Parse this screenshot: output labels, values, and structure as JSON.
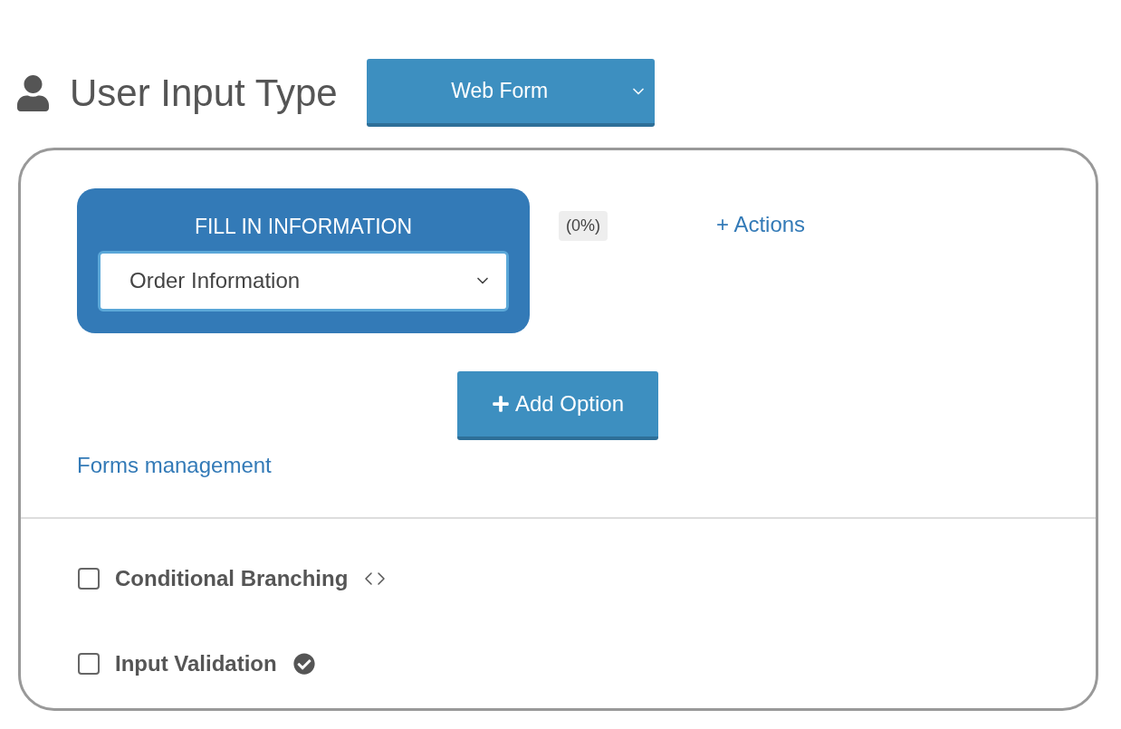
{
  "header": {
    "title": "User Input Type",
    "input_type": "Web Form"
  },
  "form_block": {
    "title": "FILL IN INFORMATION",
    "selected_form": "Order Information"
  },
  "progress": "(0%)",
  "actions_link": "+ Actions",
  "add_option_button": "Add Option",
  "forms_management_link": "Forms management",
  "options": [
    {
      "label": "Conditional Branching",
      "checked": false,
      "kind": "code"
    },
    {
      "label": "Input Validation",
      "checked": false,
      "kind": "check"
    }
  ]
}
